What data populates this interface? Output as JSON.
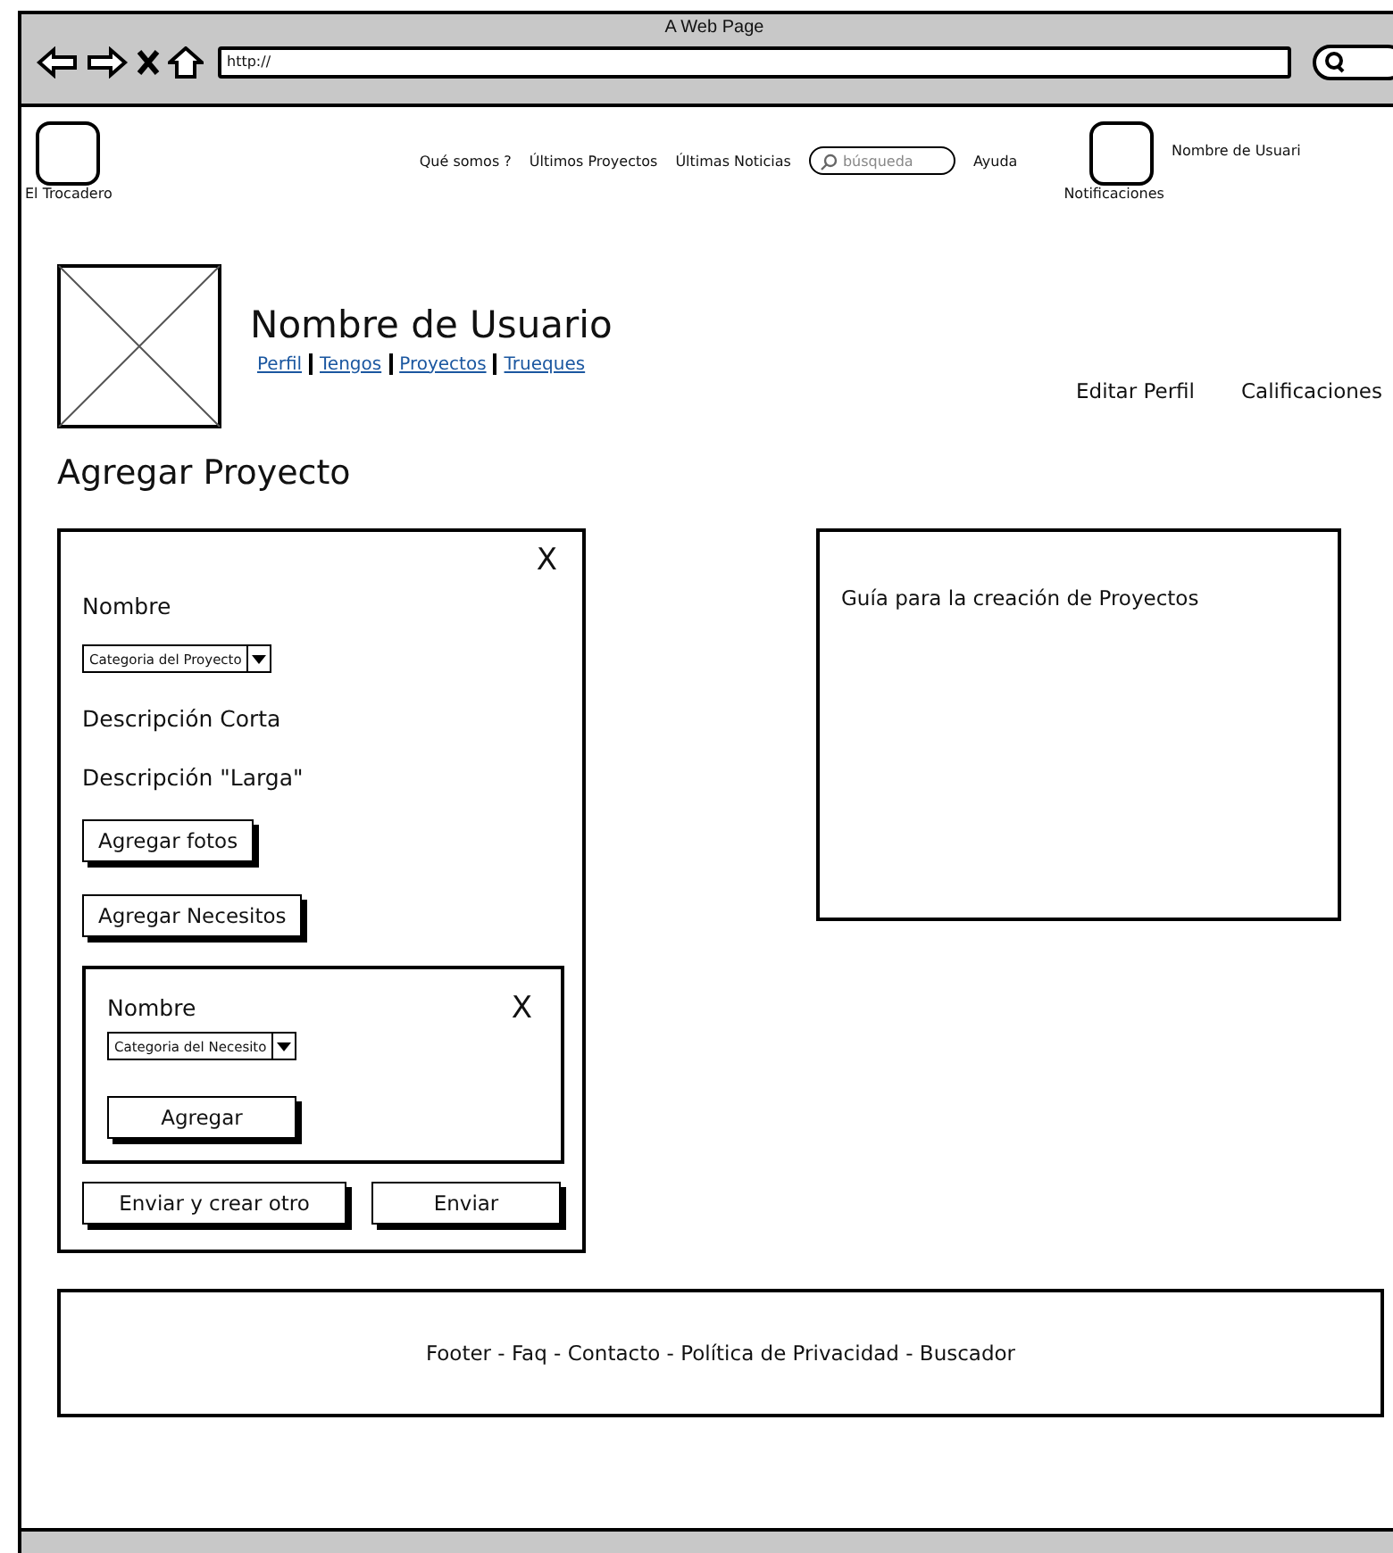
{
  "browser": {
    "title": "A Web Page",
    "url": "http://"
  },
  "header": {
    "logo_label": "El Trocadero",
    "nav": [
      "Qué somos ?",
      "Últimos Proyectos",
      "Últimas Noticias"
    ],
    "search": {
      "placeholder": "búsqueda"
    },
    "help": "Ayuda",
    "notifications_label": "Notificaciones",
    "user_name": "Nombre de Usuari"
  },
  "profile": {
    "name": "Nombre de Usuario",
    "links": [
      "Perfil",
      "Tengos",
      "Proyectos",
      "Trueques"
    ],
    "actions": [
      "Editar Perfil",
      "Calificaciones"
    ]
  },
  "page_title": "Agregar Proyecto",
  "form": {
    "close": "X",
    "fields": [
      {
        "kind": "label",
        "text": "Nombre"
      },
      {
        "kind": "select",
        "text": "Categoria del Proyecto"
      },
      {
        "kind": "label",
        "text": "Descripción Corta"
      },
      {
        "kind": "label",
        "text": "Descripción \"Larga\""
      },
      {
        "kind": "button",
        "text": "Agregar fotos"
      },
      {
        "kind": "button",
        "text": "Agregar Necesitos"
      }
    ],
    "need": {
      "close": "X",
      "name_label": "Nombre",
      "select": "Categoria del Necesito",
      "button": "Agregar"
    },
    "buttons": [
      "Enviar y crear otro",
      "Enviar"
    ]
  },
  "guide": {
    "title": "Guía para la creación de Proyectos"
  },
  "footer": "Footer - Faq - Contacto - Política de Privacidad - Buscador"
}
